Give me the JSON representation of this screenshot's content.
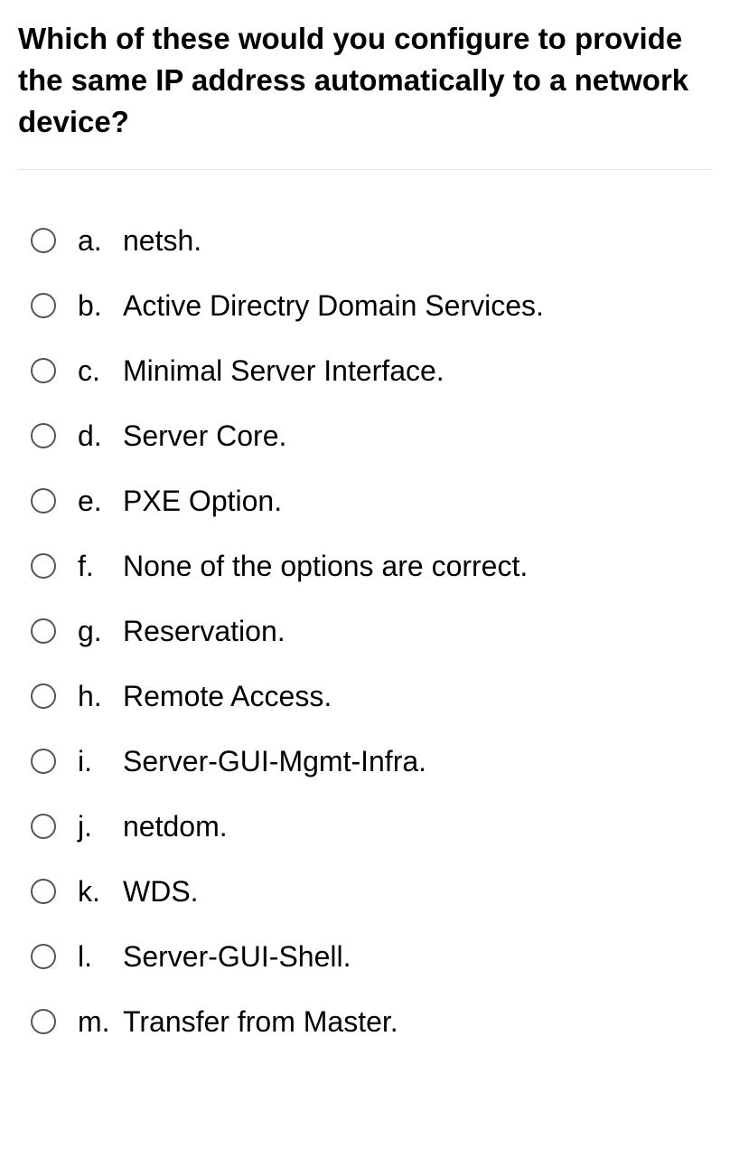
{
  "question": "Which of these would you configure to provide the same IP address automatically to a network device?",
  "options": [
    {
      "letter": "a.",
      "text": "netsh."
    },
    {
      "letter": "b.",
      "text": "Active Directry Domain Services."
    },
    {
      "letter": "c.",
      "text": "Minimal Server Interface."
    },
    {
      "letter": "d.",
      "text": "Server Core."
    },
    {
      "letter": "e.",
      "text": "PXE Option."
    },
    {
      "letter": "f.",
      "text": "None of the options are correct."
    },
    {
      "letter": "g.",
      "text": "Reservation."
    },
    {
      "letter": "h.",
      "text": "Remote Access."
    },
    {
      "letter": "i.",
      "text": "Server-GUI-Mgmt-Infra."
    },
    {
      "letter": "j.",
      "text": "netdom."
    },
    {
      "letter": "k.",
      "text": "WDS."
    },
    {
      "letter": "l.",
      "text": "Server-GUI-Shell."
    },
    {
      "letter": "m.",
      "text": "Transfer from Master."
    }
  ]
}
